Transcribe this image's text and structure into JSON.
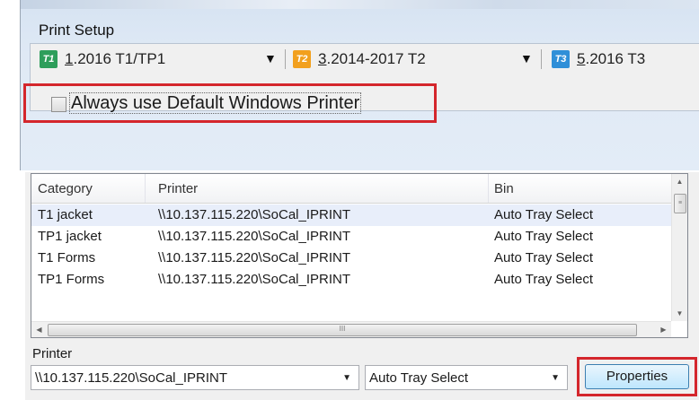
{
  "window": {
    "title": "Print Setup"
  },
  "tabs": [
    {
      "badge": "T1",
      "badge_color": "#2e9e5b",
      "num": "1",
      "label": ".2016 T1/TP1"
    },
    {
      "badge": "T2",
      "badge_color": "#f2a01e",
      "num": "3",
      "label": ".2014-2017 T2"
    },
    {
      "badge": "T3",
      "badge_color": "#2f8fd8",
      "num": "5",
      "label": ".2016 T3"
    }
  ],
  "default_printer_checkbox": {
    "label": "Always use Default Windows Printer",
    "checked": false
  },
  "table": {
    "columns": [
      "Category",
      "Printer",
      "Bin"
    ],
    "rows": [
      {
        "category": "T1 jacket",
        "printer": "\\\\10.137.115.220\\SoCal_IPRINT",
        "bin": "Auto Tray Select"
      },
      {
        "category": "TP1 jacket",
        "printer": "\\\\10.137.115.220\\SoCal_IPRINT",
        "bin": "Auto Tray Select"
      },
      {
        "category": "T1 Forms",
        "printer": "\\\\10.137.115.220\\SoCal_IPRINT",
        "bin": "Auto Tray Select"
      },
      {
        "category": "TP1 Forms",
        "printer": "\\\\10.137.115.220\\SoCal_IPRINT",
        "bin": "Auto Tray Select"
      }
    ]
  },
  "printer_section": {
    "label": "Printer",
    "printer_value": "\\\\10.137.115.220\\SoCal_IPRINT",
    "bin_value": "Auto Tray Select",
    "properties_label": "Properties"
  },
  "colors": {
    "highlight": "#d4262c",
    "accent_button": "#bee6fd"
  }
}
